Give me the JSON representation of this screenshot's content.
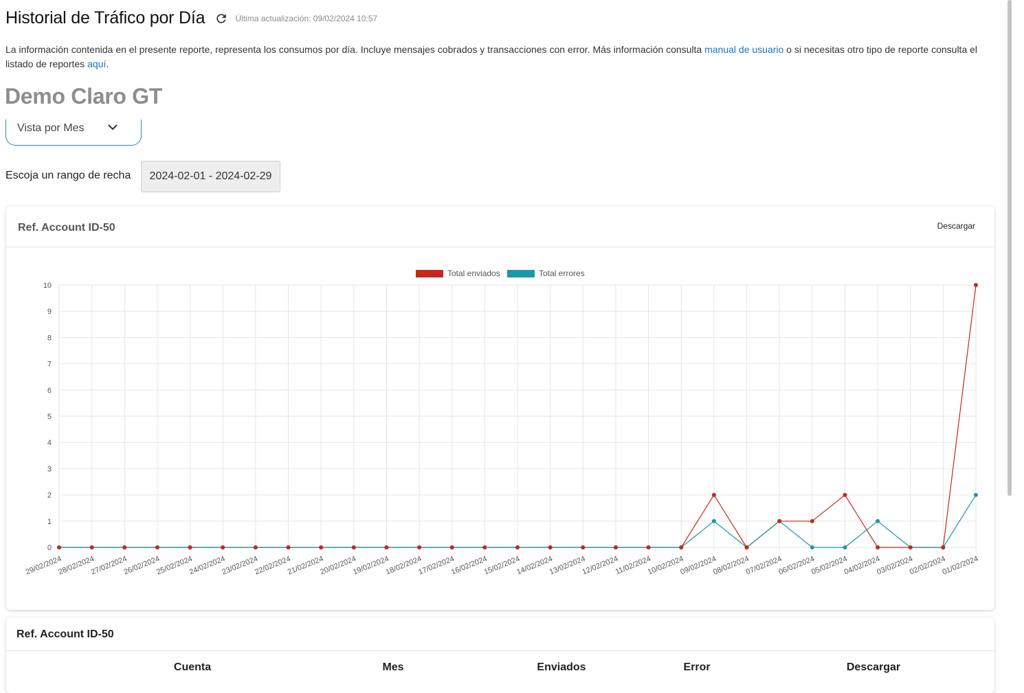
{
  "header": {
    "title": "Historial de Tráfico por Día",
    "refresh_icon": "refresh-icon",
    "last_update": "Última actualización: 09/02/2024 10:57"
  },
  "description": {
    "text1": "La información contenida en el presente reporte, representa los consumos por día. Incluye mensajes cobrados y transacciones con error. Más información consulta ",
    "link1": "manual de usuario",
    "text2": " o si necesitas otro tipo de reporte consulta el listado de reportes ",
    "link2": "aquí",
    "text3": "."
  },
  "company": "Demo Claro GT",
  "view_select": {
    "value": "Vista por Mes",
    "icon": "chevron-down-icon"
  },
  "date_range": {
    "label": "Escoja un rango de recha",
    "value": "2024-02-01 - 2024-02-29"
  },
  "chart_card": {
    "title": "Ref. Account ID-50",
    "download": "Descargar"
  },
  "table_card": {
    "title": "Ref. Account ID-50",
    "columns": [
      "Cuenta",
      "Mes",
      "Enviados",
      "Error",
      "Descargar"
    ]
  },
  "colors": {
    "enviados": "#c6281c",
    "errores": "#1a97a8",
    "link": "#1a74c4",
    "accent": "#1e90a8"
  },
  "chart_data": {
    "type": "line",
    "categories": [
      "29/02/2024",
      "28/02/2024",
      "27/02/2024",
      "26/02/2024",
      "25/02/2024",
      "24/02/2024",
      "23/02/2024",
      "22/02/2024",
      "21/02/2024",
      "20/02/2024",
      "19/02/2024",
      "18/02/2024",
      "17/02/2024",
      "16/02/2024",
      "15/02/2024",
      "14/02/2024",
      "13/02/2024",
      "12/02/2024",
      "11/02/2024",
      "10/02/2024",
      "09/02/2024",
      "08/02/2024",
      "07/02/2024",
      "06/02/2024",
      "05/02/2024",
      "04/02/2024",
      "03/02/2024",
      "02/02/2024",
      "01/02/2024"
    ],
    "series": [
      {
        "name": "Total enviados",
        "color": "#c6281c",
        "values": [
          0,
          0,
          0,
          0,
          0,
          0,
          0,
          0,
          0,
          0,
          0,
          0,
          0,
          0,
          0,
          0,
          0,
          0,
          0,
          0,
          2,
          0,
          1,
          1,
          2,
          0,
          0,
          0,
          10
        ]
      },
      {
        "name": "Total errores",
        "color": "#1a97a8",
        "values": [
          0,
          0,
          0,
          0,
          0,
          0,
          0,
          0,
          0,
          0,
          0,
          0,
          0,
          0,
          0,
          0,
          0,
          0,
          0,
          0,
          1,
          0,
          1,
          0,
          0,
          1,
          0,
          0,
          2
        ]
      }
    ],
    "ylim": [
      0,
      10
    ],
    "yticks": [
      0,
      1,
      2,
      3,
      4,
      5,
      6,
      7,
      8,
      9,
      10
    ],
    "grid": true,
    "legend": "top-center",
    "title": "",
    "xlabel": "",
    "ylabel": ""
  }
}
